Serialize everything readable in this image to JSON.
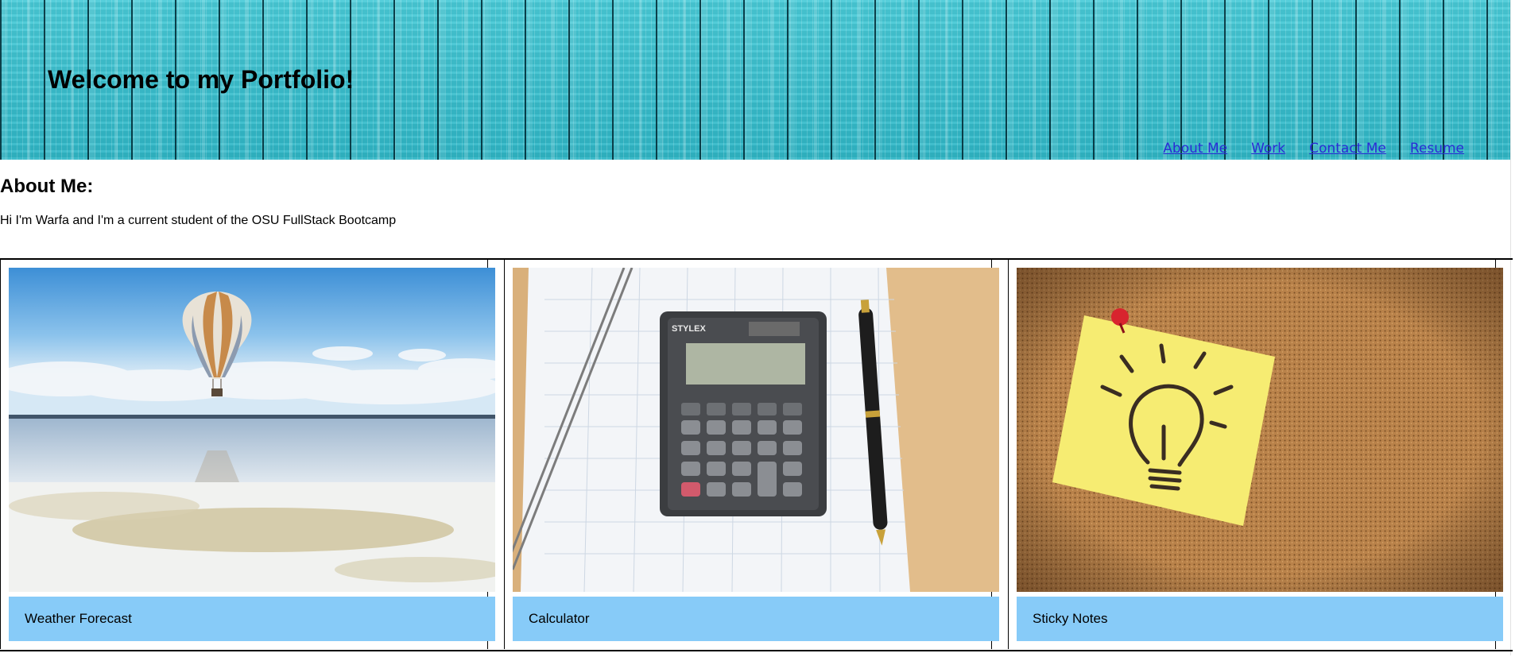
{
  "header": {
    "title": "Welcome to my Portfolio!",
    "nav": [
      {
        "label": "About Me"
      },
      {
        "label": "Work"
      },
      {
        "label": "Contact Me"
      },
      {
        "label": "Resume"
      }
    ]
  },
  "about": {
    "heading": "About Me:",
    "text": "Hi I'm Warfa and I'm a current student of the OSU FullStack Bootcamp"
  },
  "work": {
    "items": [
      {
        "caption": "Weather Forecast",
        "image": "hot-air-balloon-photo"
      },
      {
        "caption": "Calculator",
        "image": "calculator-photo"
      },
      {
        "caption": "Sticky Notes",
        "image": "sticky-note-lightbulb-photo"
      }
    ]
  },
  "colors": {
    "caption_bg": "#87cbf8",
    "link": "#2b2bd6",
    "header_wood": "#37c1cf"
  }
}
